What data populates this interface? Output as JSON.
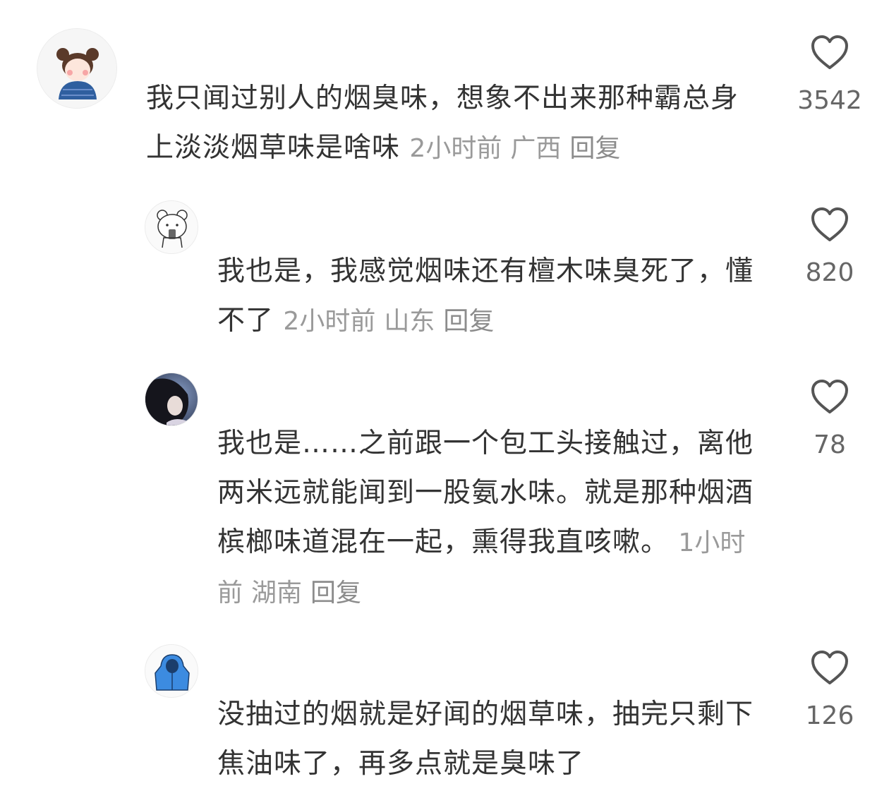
{
  "comments": [
    {
      "text": "我只闻过别人的烟臭味，想象不出来那种霸总身上淡淡烟草味是啥味",
      "time": "2小时前",
      "location": "广西",
      "reply_label": "回复",
      "likes": "3542",
      "avatar_icon": "girl-avatar-icon"
    },
    {
      "text": "我也是，我感觉烟味还有檀木味臭死了，懂不了",
      "time": "2小时前",
      "location": "山东",
      "reply_label": "回复",
      "likes": "820",
      "avatar_icon": "bear-avatar-icon"
    },
    {
      "text": "我也是……之前跟一个包工头接触过，离他两米远就能闻到一股氨水味。就是那种烟酒槟榔味道混在一起，熏得我直咳嗽。",
      "time": "1小时前",
      "location": "湖南",
      "reply_label": "回复",
      "likes": "78",
      "avatar_icon": "photo-avatar-icon"
    },
    {
      "text": "没抽过的烟就是好闻的烟草味，抽完只剩下焦油味了，再多点就是臭味了",
      "likes": "126",
      "avatar_icon": "hoodie-avatar-icon"
    }
  ]
}
